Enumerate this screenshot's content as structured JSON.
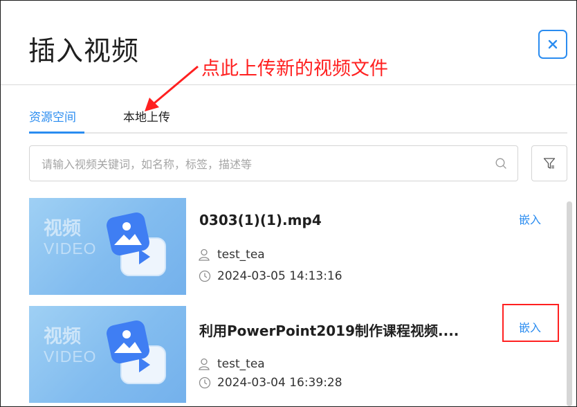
{
  "dialog": {
    "title": "插入视频"
  },
  "annotation": {
    "text": "点此上传新的视频文件",
    "color": "#ff2020"
  },
  "tabs": [
    {
      "label": "资源空间",
      "active": true
    },
    {
      "label": "本地上传",
      "active": false
    }
  ],
  "search": {
    "value": "",
    "placeholder": "请输入视频关键词，如名称，标签，描述等"
  },
  "thumbnail": {
    "text_cn": "视频",
    "text_en": "VIDEO"
  },
  "videos": [
    {
      "title": "0303(1)(1).mp4",
      "author": "test_tea",
      "time": "2024-03-05 14:13:16",
      "embed_label": "嵌入",
      "embed_highlighted": false
    },
    {
      "title": "利用PowerPoint2019制作课程视频....",
      "author": "test_tea",
      "time": "2024-03-04 16:39:28",
      "embed_label": "嵌入",
      "embed_highlighted": true
    }
  ],
  "colors": {
    "accent": "#2a8cf0",
    "highlight": "#ff2020"
  }
}
